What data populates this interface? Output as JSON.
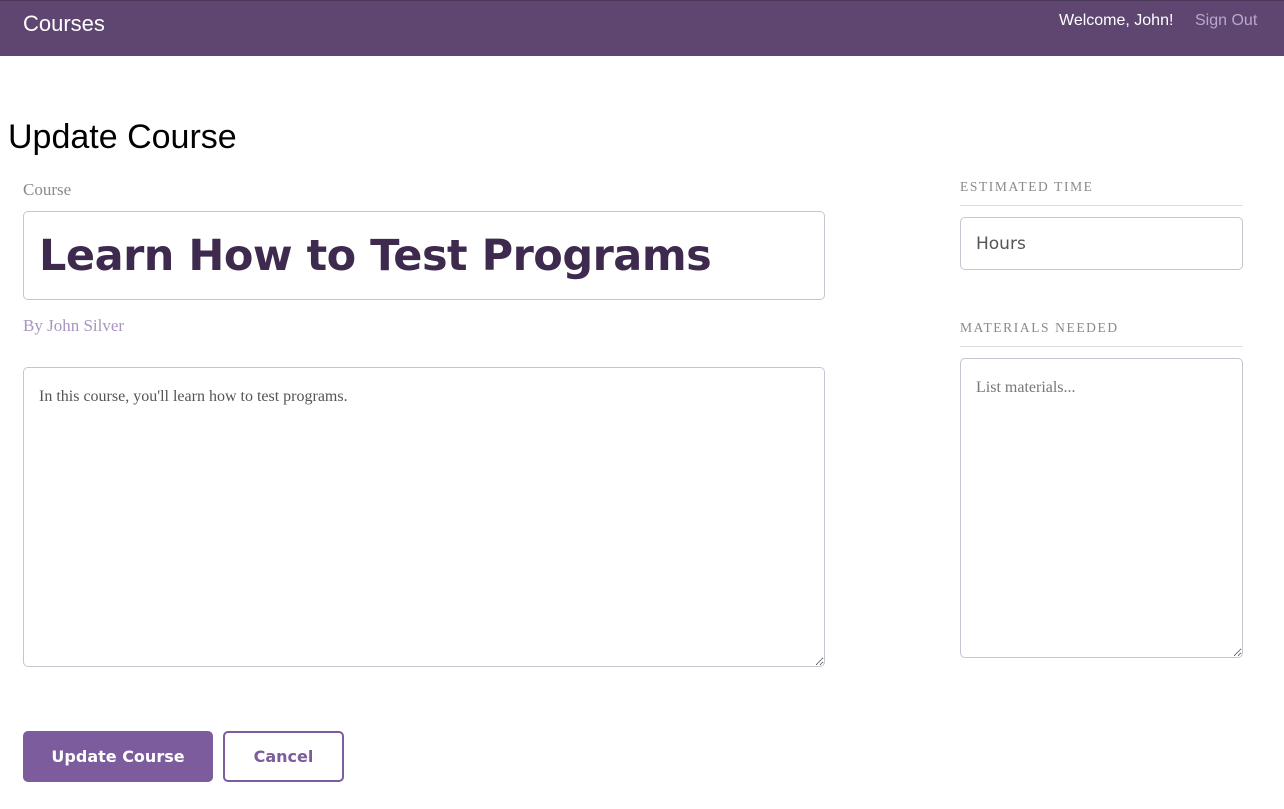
{
  "header": {
    "brand": "Courses",
    "welcome": "Welcome, John!",
    "sign_out": "Sign Out"
  },
  "page": {
    "title": "Update Course"
  },
  "course": {
    "label": "Course",
    "title_value": "Learn How to Test Programs",
    "author": "By John Silver",
    "description_value": "In this course, you'll learn how to test programs."
  },
  "sidebar": {
    "estimated_time_heading": "Estimated Time",
    "hours_placeholder": "Hours",
    "materials_heading": "Materials Needed",
    "materials_placeholder": "List materials..."
  },
  "actions": {
    "submit_label": "Update Course",
    "cancel_label": "Cancel"
  },
  "colors": {
    "header_bg": "#5e4671",
    "accent": "#7c5c9c",
    "title_text": "#3d2a4e"
  }
}
